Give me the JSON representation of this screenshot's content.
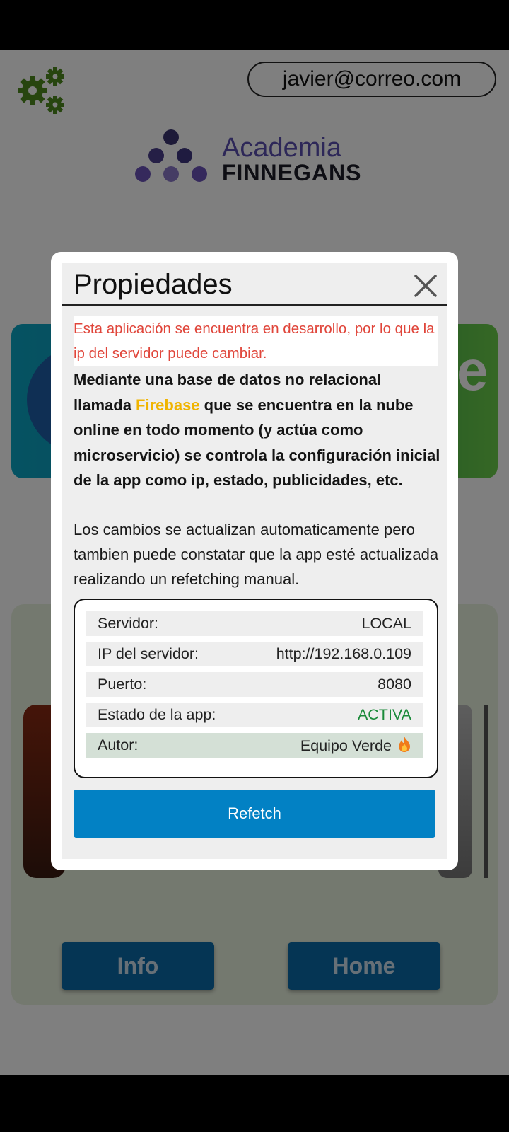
{
  "header": {
    "user_email": "javier@correo.com",
    "settings_icon": "gears-icon"
  },
  "logo": {
    "line1": "Academia",
    "line2": "FINNEGANS",
    "dot_colors": [
      "#3b3470",
      "#4a3e8c",
      "#5a4fb0",
      "#6a52b8",
      "#8a78c8",
      "#6a52b8"
    ]
  },
  "buttons": {
    "info_label": "Info",
    "home_label": "Home"
  },
  "modal": {
    "title": "Propiedades",
    "close_icon": "close-icon",
    "warning": "Esta aplicación se encuentra en desarrollo, por lo que la ip del servidor puede cambiar.",
    "desc_part1": "Mediante una base de datos no relacional llamada ",
    "desc_highlight": "Firebase",
    "desc_part2": " que se encuentra en la nube online en todo momento (y actúa como microservicio) se controla la configuración inicial de la app como ip, estado, publicidades, etc.",
    "desc_plain": "Los cambios se actualizan automaticamente pero tambien puede constatar que la app esté actualizada realizando un refetching manual.",
    "rows": [
      {
        "label": "Servidor:",
        "value": "LOCAL"
      },
      {
        "label": "IP del servidor:",
        "value": "http://192.168.0.109"
      },
      {
        "label": "Puerto:",
        "value": "8080"
      },
      {
        "label": "Estado de la app:",
        "value": "ACTIVA"
      },
      {
        "label": "Autor:",
        "value": "Equipo Verde"
      }
    ],
    "refetch_label": "Refetch",
    "colors": {
      "warning": "#e0453a",
      "highlight": "#f0b400",
      "status_active": "#1b8a3a",
      "button": "#0281c4"
    }
  }
}
